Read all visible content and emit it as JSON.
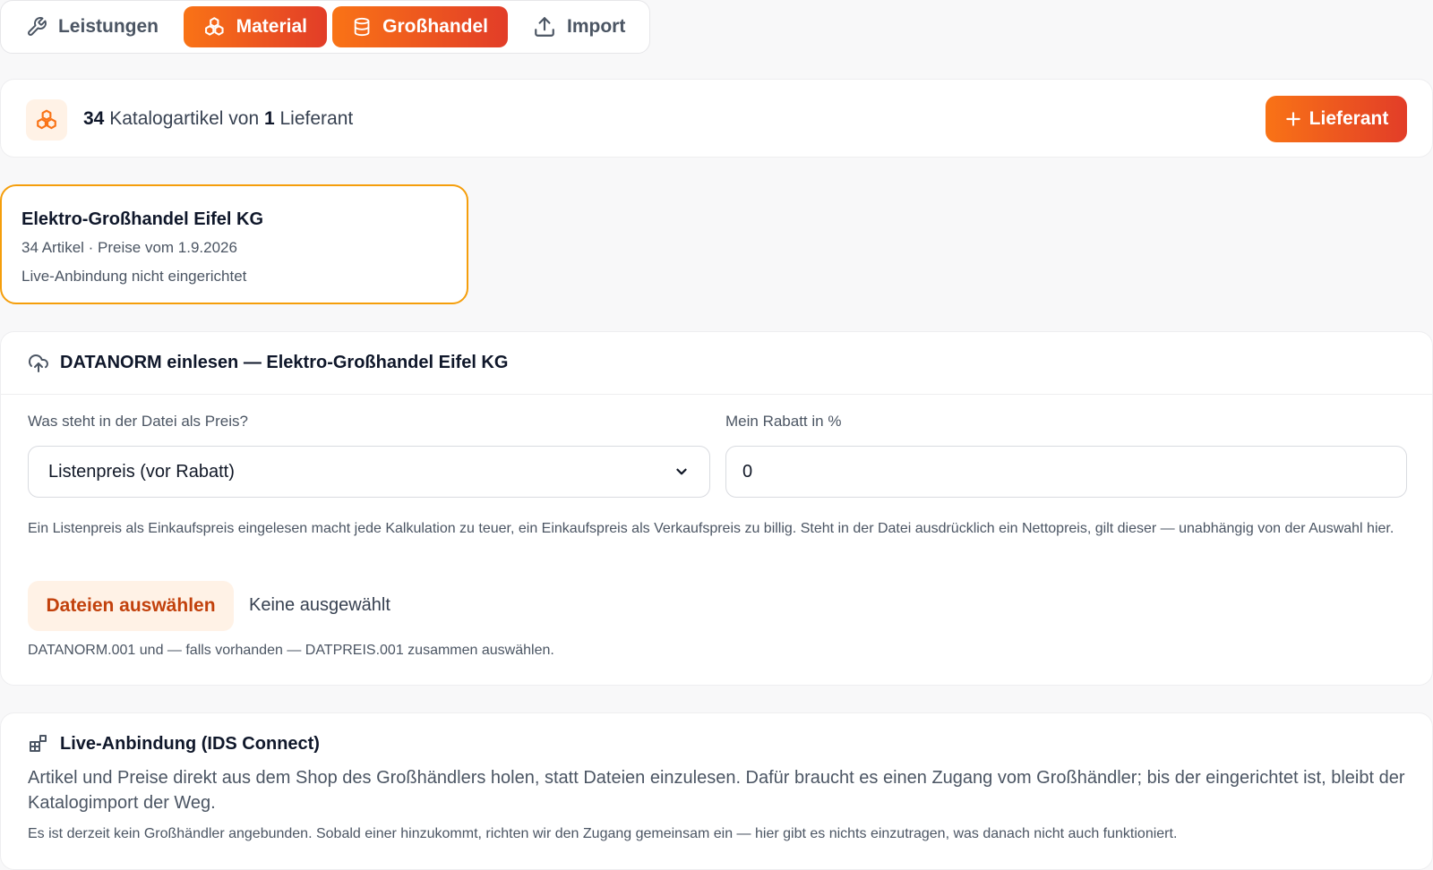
{
  "tabs": [
    {
      "label": "Leistungen",
      "icon": "wrench-icon",
      "active": false
    },
    {
      "label": "Material",
      "icon": "cubes-icon",
      "active": true
    },
    {
      "label": "Großhandel",
      "icon": "database-icon",
      "active": true
    },
    {
      "label": "Import",
      "icon": "upload-icon",
      "active": false
    }
  ],
  "summary": {
    "article_count": "34",
    "text_mid": " Katalogartikel von ",
    "supplier_count": "1",
    "text_end": " Lieferant",
    "add_button": "Lieferant"
  },
  "supplier": {
    "name": "Elektro-Großhandel Eifel KG",
    "meta": "34 Artikel · Preise vom 1.9.2026",
    "live": "Live-Anbindung nicht eingerichtet"
  },
  "datanorm": {
    "title": "DATANORM einlesen — Elektro-Großhandel Eifel KG",
    "price_label": "Was steht in der Datei als Preis?",
    "price_value": "Listenpreis (vor Rabatt)",
    "discount_label": "Mein Rabatt in %",
    "discount_value": "0",
    "hint": "Ein Listenpreis als Einkaufspreis eingelesen macht jede Kalkulation zu teuer, ein Einkaufspreis als Verkaufspreis zu billig. Steht in der Datei ausdrücklich ein Nettopreis, gilt dieser — unabhängig von der Auswahl hier.",
    "file_button": "Dateien auswählen",
    "file_status": "Keine ausgewählt",
    "file_hint": "DATANORM.001 und — falls vorhanden — DATPREIS.001 zusammen auswählen."
  },
  "ids": {
    "title": "Live-Anbindung (IDS Connect)",
    "description": "Artikel und Preise direkt aus dem Shop des Großhändlers holen, statt Dateien einzulesen. Dafür braucht es einen Zugang vom Großhändler; bis der eingerichtet ist, bleibt der Katalogimport der Weg.",
    "note": "Es ist derzeit kein Großhändler angebunden. Sobald einer hinzukommt, richten wir den Zugang gemeinsam ein — hier gibt es nichts einzutragen, was danach nicht auch funktioniert."
  },
  "colors": {
    "accent": "#f97316",
    "accent_end": "#e23d28",
    "card_border": "#f59e0b"
  }
}
